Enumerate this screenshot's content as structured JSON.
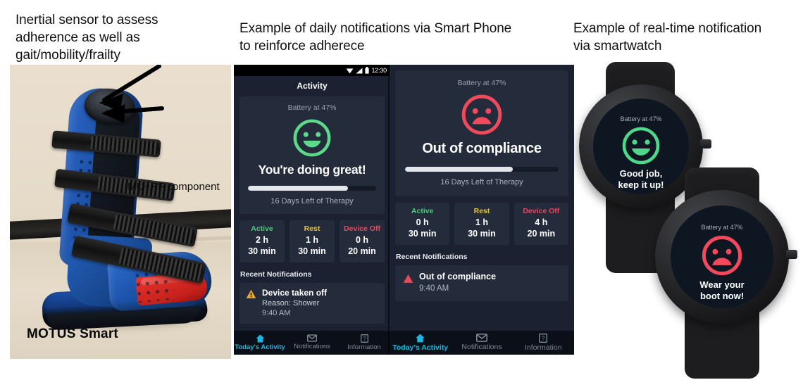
{
  "captions": {
    "boot": "Inertial sensor to assess\nadherence as well as\ngait/mobility/frailty",
    "phone": "Example of daily notifications via Smart Phone\nto reinforce adherece",
    "watch": "Example of real-time notification\nvia smartwatch"
  },
  "boot_photo": {
    "callout_label": "IMU+RF component",
    "product_label": "MOTUS Smart"
  },
  "phone1": {
    "statusbar": {
      "time": "12:30",
      "icons": [
        "wifi-icon",
        "signal-icon",
        "battery-icon"
      ]
    },
    "app_title": "Activity",
    "battery_text": "Battery at 47%",
    "face": "smiley-happy-icon",
    "face_color": "#5dd98a",
    "headline": "You're doing great!",
    "progress_percent": 78,
    "therapy_days": "16 Days Left of Therapy",
    "stats": [
      {
        "label": "Active",
        "value_line1": "2 h",
        "value_line2": "30 min",
        "color": "#4cc97a"
      },
      {
        "label": "Rest",
        "value_line1": "1 h",
        "value_line2": "30 min",
        "color": "#e3c13c"
      },
      {
        "label": "Device Off",
        "value_line1": "0 h",
        "value_line2": "20 min",
        "color": "#e8475e"
      }
    ],
    "recent_header": "Recent Notifications",
    "notification": {
      "icon": "warning-triangle-icon",
      "icon_color": "#f0a92b",
      "title": "Device taken off",
      "subtitle": "Reason: Shower",
      "time": "9:40 AM"
    },
    "nav": [
      {
        "label": "Today's Activity",
        "icon": "home-icon",
        "active": true
      },
      {
        "label": "Notifications",
        "icon": "mail-icon",
        "active": false
      },
      {
        "label": "Information",
        "icon": "help-icon",
        "active": false
      }
    ]
  },
  "phone2": {
    "battery_text": "Battery at 47%",
    "face": "smiley-sad-icon",
    "face_color": "#f2495c",
    "headline": "Out of compliance",
    "progress_percent": 70,
    "therapy_days": "16 Days Left of Therapy",
    "stats": [
      {
        "label": "Active",
        "value_line1": "0 h",
        "value_line2": "30 min",
        "color": "#4cc97a"
      },
      {
        "label": "Rest",
        "value_line1": "1 h",
        "value_line2": "30 min",
        "color": "#e3c13c"
      },
      {
        "label": "Device Off",
        "value_line1": "4 h",
        "value_line2": "20 min",
        "color": "#e8475e"
      }
    ],
    "recent_header": "Recent Notifications",
    "notification": {
      "icon": "alert-triangle-icon",
      "icon_color": "#e8475e",
      "title": "Out of compliance",
      "time": "9:40 AM"
    },
    "nav": [
      {
        "label": "Today's Activity",
        "icon": "home-icon",
        "active": true
      },
      {
        "label": "Notifications",
        "icon": "mail-icon",
        "active": false
      },
      {
        "label": "Information",
        "icon": "help-icon",
        "active": false
      }
    ]
  },
  "watch1": {
    "battery_text": "Battery at 47%",
    "face": "smiley-happy-icon",
    "face_color": "#4ed98a",
    "message": "Good job,\nkeep it up!"
  },
  "watch2": {
    "battery_text": "Battery at 47%",
    "face": "smiley-sad-icon",
    "face_color": "#f2495c",
    "message": "Wear your\nboot now!"
  }
}
